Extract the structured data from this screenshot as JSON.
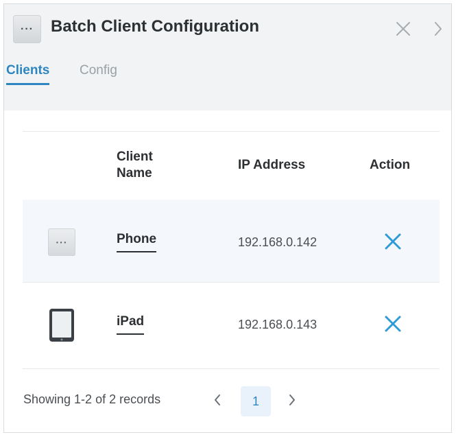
{
  "dialog": {
    "title": "Batch Client Configuration",
    "title_icon": "more-dots-icon",
    "title_icon_text": "···",
    "close_icon": "close-icon",
    "next_icon": "chevron-right-icon"
  },
  "tabs": [
    {
      "label": "Clients",
      "active": true
    },
    {
      "label": "Config",
      "active": false
    }
  ],
  "table": {
    "columns": [
      "Client Name",
      "IP Address",
      "Action"
    ],
    "rows": [
      {
        "device_icon": "generic-device-icon",
        "device_icon_text": "···",
        "name": "Phone",
        "ip": "192.168.0.142",
        "action_icon": "remove-x-icon"
      },
      {
        "device_icon": "tablet-icon",
        "name": "iPad",
        "ip": "192.168.0.143",
        "action_icon": "remove-x-icon"
      }
    ]
  },
  "pagination": {
    "records_text": "Showing 1-2 of 2 records",
    "current_page": "1",
    "prev_icon": "chevron-left-icon",
    "next_icon": "chevron-right-icon"
  },
  "colors": {
    "accent": "#2e86c1",
    "action_x": "#2d9bd6",
    "header_bg": "#f1f3f4",
    "row_highlight": "#f4f7fb"
  }
}
